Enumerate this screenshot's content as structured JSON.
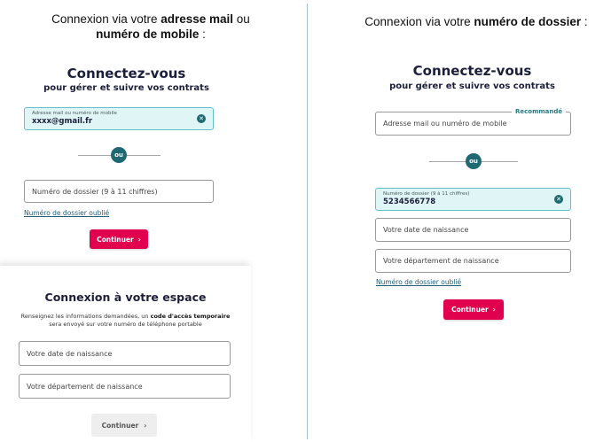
{
  "left": {
    "caption": {
      "prefix": "Connexion via votre ",
      "bold1": "adresse mail",
      "middle": " ou",
      "bold2": "numéro de mobile",
      "suffix": " :"
    },
    "title": "Connectez-vous",
    "subtitle": "pour gérer et suivre vos contrats",
    "email_field": {
      "label": "Adresse mail ou numéro de mobile",
      "value": "xxxx@gmail.fr"
    },
    "or_label": "ou",
    "dossier_field": {
      "placeholder": "Numéro de dossier (9 à 11 chiffres)"
    },
    "forgot_link": "Numéro de dossier oublié",
    "continue_label": "Continuer",
    "panel": {
      "title": "Connexion à votre espace",
      "text_before": "Renseignez les informations demandées, un ",
      "text_bold": "code d'accès temporaire",
      "text_after": "sera envoyé sur votre numéro de téléphone portable",
      "birthdate_placeholder": "Votre date de naissance",
      "department_placeholder": "Votre département de naissance",
      "continue_label": "Continuer"
    }
  },
  "right": {
    "caption": {
      "prefix": "Connexion via votre ",
      "bold": "numéro de dossier",
      "suffix": " :"
    },
    "title": "Connectez-vous",
    "subtitle": "pour gérer et suivre vos contrats",
    "email_field": {
      "placeholder": "Adresse mail ou numéro de mobile",
      "badge": "Recommandé"
    },
    "or_label": "ou",
    "dossier_field": {
      "label": "Numéro de dossier (9 à 11 chiffres)",
      "value": "5234566778"
    },
    "birthdate_placeholder": "Votre date de naissance",
    "department_placeholder": "Votre département de naissance",
    "forgot_link": "Numéro de dossier oublié",
    "continue_label": "Continuer"
  },
  "icons": {
    "clear": "close-circle-icon",
    "chevron": "chevron-right-icon"
  },
  "colors": {
    "primary": "#e0004d",
    "teal": "#1f6a72",
    "filled_bg": "#e0f5f6",
    "title": "#1b1f3b"
  }
}
